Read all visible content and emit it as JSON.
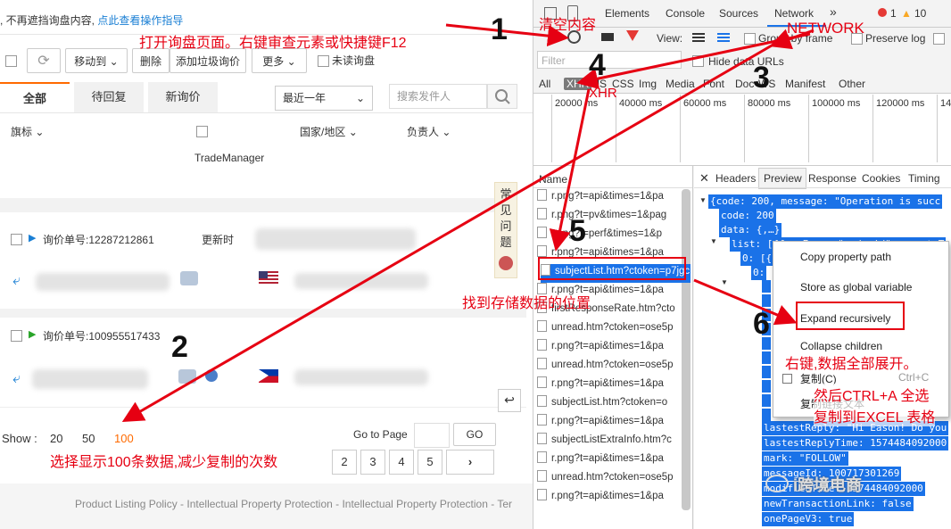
{
  "left": {
    "notice_text": ", 不再遮挡询盘内容,",
    "notice_link": "点此查看操作指导",
    "toolbar": {
      "move_to": "移动到",
      "delete": "删除",
      "add_trash": "添加垃圾询价",
      "more": "更多",
      "unread": "未读询盘"
    },
    "tabs": [
      "全部",
      "待回复",
      "新询价"
    ],
    "date_filter": "最近一年",
    "search_placeholder": "搜索发件人",
    "columns": {
      "flag": "旗标",
      "country": "国家/地区",
      "owner": "负责人",
      "trade_manager": "TradeManager"
    },
    "faq": "常见问题",
    "inquiries": [
      {
        "label": "询价单号:",
        "number": "12287212861",
        "updated": "更新时"
      },
      {
        "label": "询价单号:",
        "number": "100955517433"
      }
    ],
    "show_label": "Show :",
    "show_options": [
      "20",
      "50",
      "100"
    ],
    "go_to_page": "Go to Page",
    "go_button": "GO",
    "pages": [
      "2",
      "3",
      "4",
      "5"
    ],
    "footer": "Product Listing Policy - Intellectual Property Protection - Intellectual Property Protection - Ter"
  },
  "devtools": {
    "tabs": [
      "Elements",
      "Console",
      "Sources",
      "Network"
    ],
    "more_tabs": "»",
    "errors": "1",
    "warnings": "10",
    "view_label": "View:",
    "group_by_frame": "Group by frame",
    "preserve_log": "Preserve log",
    "filter_placeholder": "Filter",
    "hide_data_urls": "Hide data URLs",
    "types": [
      "All",
      "XHR",
      "JS",
      "CSS",
      "Img",
      "Media",
      "Font",
      "Doc",
      "WS",
      "Manifest",
      "Other"
    ],
    "timeline_ticks": [
      "20000 ms",
      "40000 ms",
      "60000 ms",
      "80000 ms",
      "100000 ms",
      "120000 ms",
      "14"
    ],
    "name_header": "Name",
    "requests": [
      "r.png?t=api&times=1&pa",
      "r.png?t=pv&times=1&pag",
      "r.png?t=perf&times=1&p",
      "r.png?t=api&times=1&pa",
      "subjectList.htm?ctoken=p7jgc",
      "r.png?t=api&times=1&pa",
      "firstResponseRate.htm?cto",
      "unread.htm?ctoken=ose5p",
      "r.png?t=api&times=1&pa",
      "unread.htm?ctoken=ose5p",
      "r.png?t=api&times=1&pa",
      "subjectList.htm?ctoken=o",
      "r.png?t=api&times=1&pa",
      "subjectListExtraInfo.htm?c",
      "r.png?t=api&times=1&pa",
      "unread.htm?ctoken=ose5p",
      "r.png?t=api&times=1&pa"
    ],
    "panel_tabs": [
      "Headers",
      "Preview",
      "Response",
      "Cookies",
      "Timing"
    ],
    "json_lines": [
      "{code: 200, message: \"Operation is succ",
      "code: 200",
      "data: {,…}",
      "list: [{fromFrom: \"android\", createT",
      "0: [{",
      "0:"
    ],
    "json_lower": [
      "lastestReply: \"Hi Eason! Do you",
      "lastestReplyTime: 1574484092000",
      "mark: \"FOLLOW\"",
      "messageId: 100717301269",
      "modifiedTime: 1574484092000",
      "newTransactionLink: false",
      "onePageV3: true"
    ],
    "context_menu": {
      "copy_path": "Copy property path",
      "store_global": "Store as global variable",
      "expand": "Expand recursively",
      "collapse": "Collapse children",
      "copy": "复制(C)",
      "copy_shortcut": "Ctrl+C",
      "copy_link": "复制链接文本"
    }
  },
  "annotations": {
    "open_inquiry": "打开询盘页面。右键审查元素或快捷键F12",
    "clear": "清空内容",
    "network": "NETWORK",
    "xhr": "XHR",
    "find_data": "找到存储数据的位置",
    "expand_all": "右键,数据全部展开。",
    "ctrl_a": "然后CTRL+A 全选",
    "copy_excel": "复制到EXCEL 表格",
    "show_100": "选择显示100条数据,减少复制的次数",
    "numbers": [
      "1",
      "2",
      "3",
      "4",
      "5",
      "6"
    ],
    "watermark": "i跨境电商"
  },
  "colors": {
    "annotation": "#e60012",
    "accent": "#ff6a00",
    "selection": "#1a72e8"
  }
}
